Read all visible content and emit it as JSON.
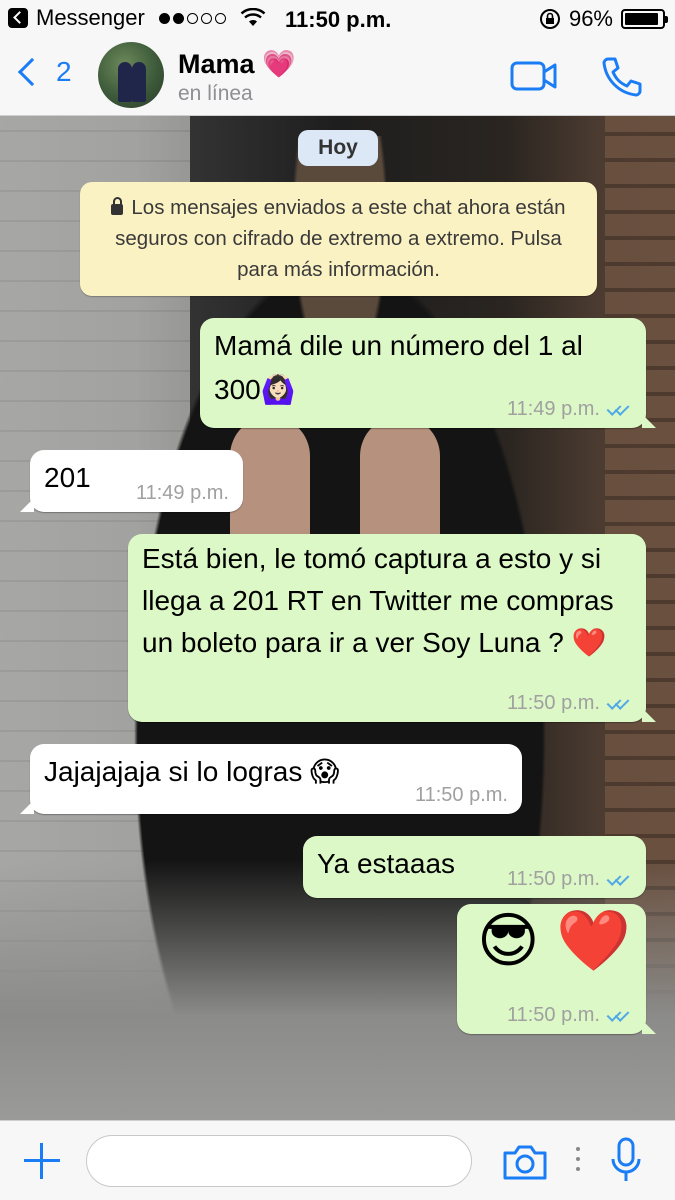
{
  "status_bar": {
    "back_app": "Messenger",
    "time": "11:50 p.m.",
    "battery": "96%",
    "battery_level": 0.96
  },
  "header": {
    "back_count": "2",
    "contact_name": "Mama 💗",
    "contact_status": "en línea"
  },
  "chat": {
    "date_chip": "Hoy",
    "encryption_notice": "Los mensajes enviados a este chat ahora están seguros con cifrado de extremo a extremo. Pulsa para más información.",
    "messages": [
      {
        "direction": "out",
        "text": "Mamá dile un número del 1 al 300🙆🏻‍♀️",
        "time": "11:49 p.m.",
        "status": "read"
      },
      {
        "direction": "in",
        "text": "201",
        "time": "11:49 p.m."
      },
      {
        "direction": "out",
        "text": "Está bien, le tomó captura a esto y si llega a 201 RT en Twitter me compras un boleto para ir a ver Soy Luna ? ❤️",
        "time": "11:50 p.m.",
        "status": "read"
      },
      {
        "direction": "in",
        "text": "Jajajajaja si lo logras 😱",
        "time": "11:50 p.m."
      },
      {
        "direction": "out",
        "text": "Ya estaaas",
        "time": "11:50 p.m.",
        "status": "read"
      },
      {
        "direction": "out",
        "text": "😎 ❤️",
        "time": "11:50 p.m.",
        "status": "read"
      }
    ]
  },
  "input_bar": {
    "placeholder": ""
  },
  "colors": {
    "accent": "#1a7df5",
    "outgoing_bubble": "#dcf8c6",
    "incoming_bubble": "#ffffff",
    "notice_bg": "#fbf2c4",
    "read_ticks": "#4fa9e8"
  },
  "icons": [
    "back-app-icon",
    "wifi-icon",
    "orientation-lock-icon",
    "battery-icon",
    "back-chevron-icon",
    "video-call-icon",
    "phone-icon",
    "lock-icon",
    "read-ticks-icon",
    "plus-icon",
    "camera-icon",
    "more-icon",
    "microphone-icon"
  ]
}
